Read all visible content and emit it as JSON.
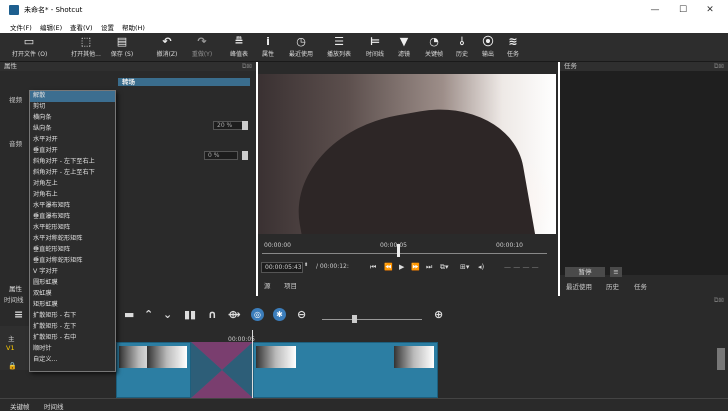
{
  "window": {
    "title": "未命名* - Shotcut",
    "min": "—",
    "max": "☐",
    "close": "✕"
  },
  "menu": [
    "文件(F)",
    "编辑(E)",
    "查看(V)",
    "设置",
    "帮助(H)"
  ],
  "toolbar": [
    {
      "icon": "▭",
      "label": "打开文件 (O)"
    },
    {
      "icon": "⬚",
      "label": "打开其他..."
    },
    {
      "icon": "▤",
      "label": "保存 (S)"
    },
    {
      "icon": "↶",
      "label": "撤消(Z)"
    },
    {
      "icon": "↷",
      "label": "重做(Y)"
    },
    {
      "icon": "≞",
      "label": "峰值表"
    },
    {
      "icon": "i",
      "label": "属性"
    },
    {
      "icon": "◷",
      "label": "最近使用"
    },
    {
      "icon": "☰",
      "label": "播放列表"
    },
    {
      "icon": "⊨",
      "label": "时间线"
    },
    {
      "icon": "▼",
      "label": "滤镜"
    },
    {
      "icon": "◔",
      "label": "关键帧"
    },
    {
      "icon": "⫰",
      "label": "历史"
    },
    {
      "icon": "⦿",
      "label": "输出"
    },
    {
      "icon": "≋",
      "label": "任务"
    }
  ],
  "properties": {
    "header": "属性",
    "transition_title": "转场",
    "video_label": "视频",
    "audio_label": "音频",
    "spin1": "20 %",
    "spin2": "0 %",
    "tab_properties": "属性"
  },
  "dropdown": [
    "解散",
    "剪切",
    "横向条",
    "纵向条",
    "水平对开",
    "垂直对开",
    "斜角对开 - 左下至右上",
    "斜角对开 - 左上至右下",
    "对角左上",
    "对角右上",
    "水平瀑布矩阵",
    "垂直瀑布矩阵",
    "水平蛇形矩阵",
    "水平对称蛇形矩阵",
    "垂直蛇形矩阵",
    "垂直对称蛇形矩阵",
    "V 字对开",
    "圆形虹膜",
    "双虹膜",
    "矩形虹膜",
    "扩散矩形 - 右下",
    "扩散矩形 - 左下",
    "扩散矩形 - 右中",
    "顺时针",
    "自定义..."
  ],
  "preview": {
    "ruler": [
      "00:00:00",
      "00:00:05",
      "00:00:10"
    ],
    "current_timecode": "00:00:05:43",
    "total_timecode": "/ 00:00:12:",
    "source_tab": "源",
    "project_tab": "项目"
  },
  "tasks": {
    "header": "任务",
    "pause": "暂停",
    "menu": "≡",
    "tabs": [
      "最近使用",
      "历史",
      "任务"
    ]
  },
  "timeline": {
    "header": "时间线",
    "track_main": "主",
    "track_v1": "V1",
    "playhead_time": "00:00:05"
  },
  "bottom_tabs": [
    "关键帧",
    "时间线"
  ],
  "colors": {
    "accent": "#3c6e90",
    "clip": "#2c7ea3",
    "transition": "#3a6a88"
  }
}
